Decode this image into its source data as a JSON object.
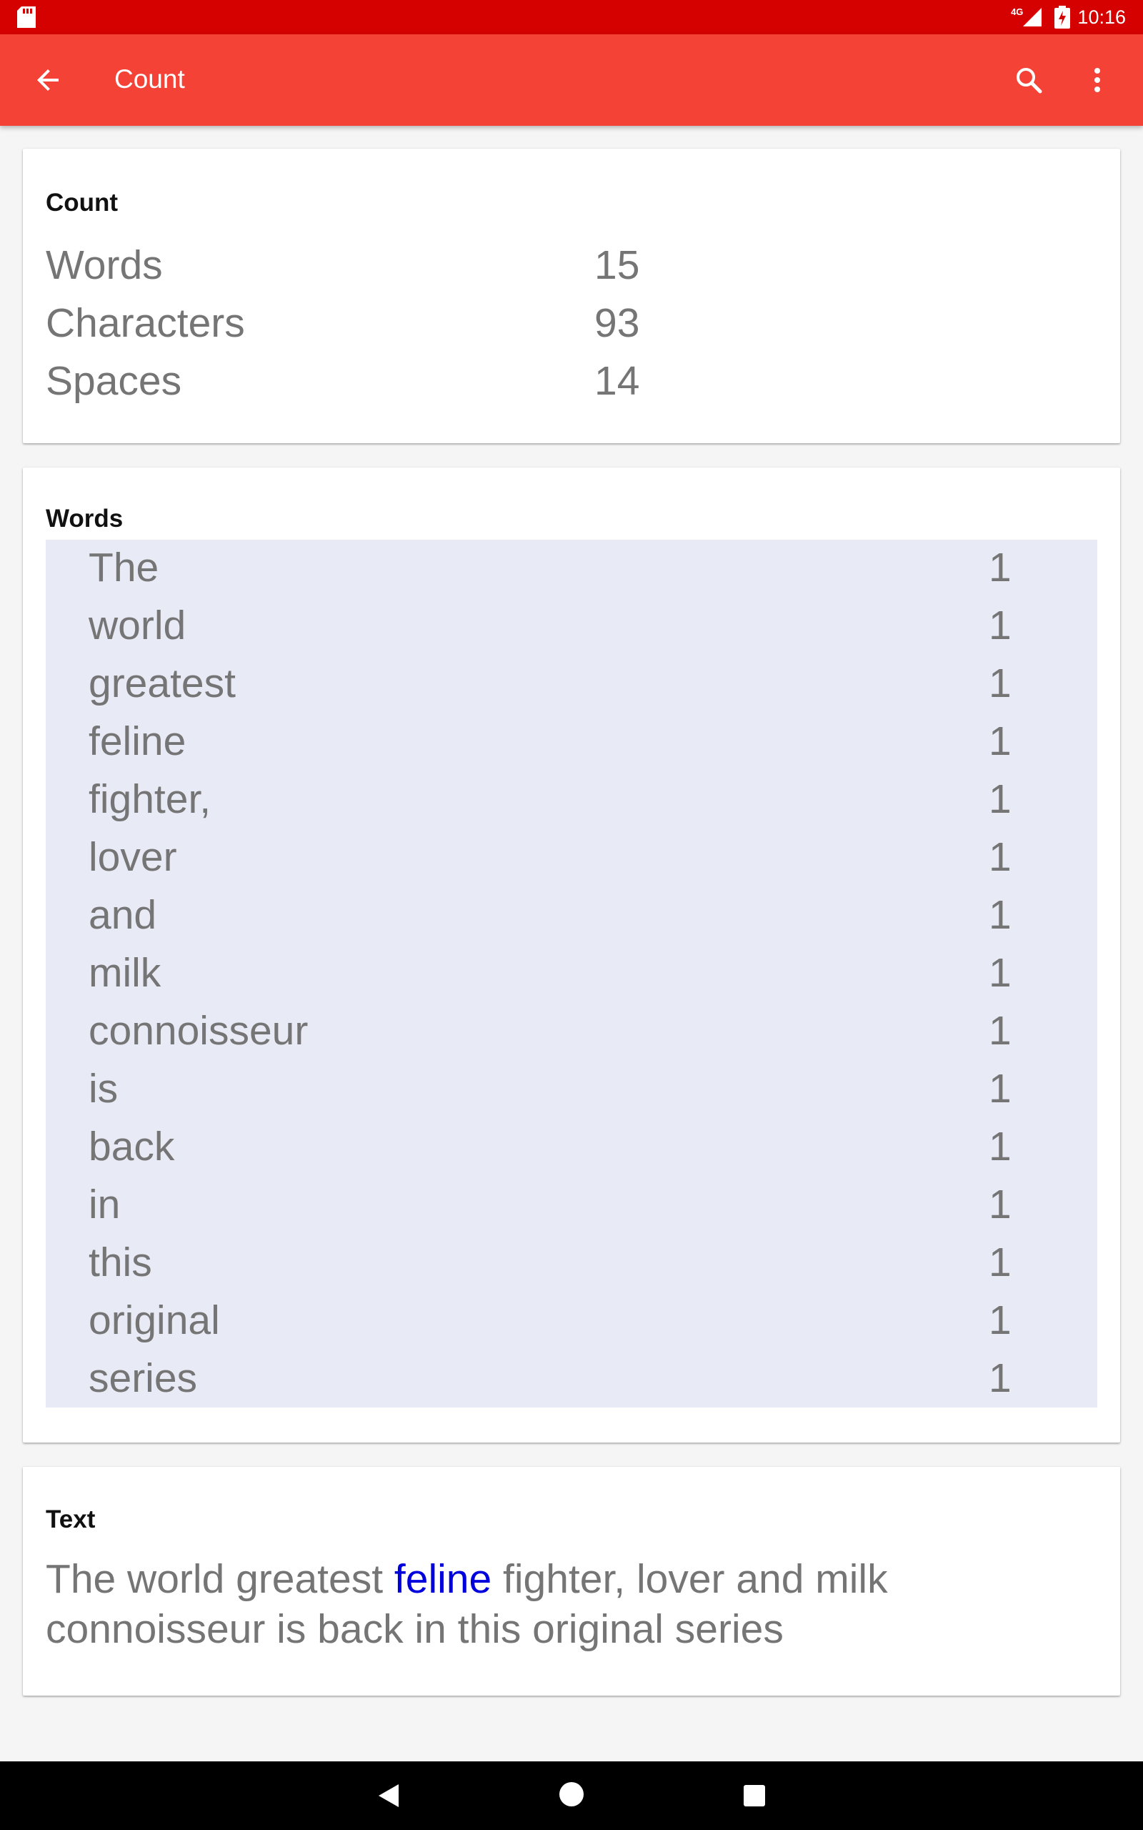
{
  "status_bar": {
    "network": "4G",
    "time": "10:16"
  },
  "app_bar": {
    "title": "Count"
  },
  "count_card": {
    "title": "Count",
    "rows": [
      {
        "label": "Words",
        "value": "15"
      },
      {
        "label": "Characters",
        "value": "93"
      },
      {
        "label": "Spaces",
        "value": "14"
      }
    ]
  },
  "words_card": {
    "title": "Words",
    "items": [
      {
        "word": "The",
        "count": "1"
      },
      {
        "word": "world",
        "count": "1"
      },
      {
        "word": "greatest",
        "count": "1"
      },
      {
        "word": "feline",
        "count": "1"
      },
      {
        "word": "fighter,",
        "count": "1"
      },
      {
        "word": "lover",
        "count": "1"
      },
      {
        "word": "and",
        "count": "1"
      },
      {
        "word": "milk",
        "count": "1"
      },
      {
        "word": "connoisseur",
        "count": "1"
      },
      {
        "word": "is",
        "count": "1"
      },
      {
        "word": "back",
        "count": "1"
      },
      {
        "word": "in",
        "count": "1"
      },
      {
        "word": "this",
        "count": "1"
      },
      {
        "word": "original",
        "count": "1"
      },
      {
        "word": "series",
        "count": "1"
      }
    ]
  },
  "text_card": {
    "title": "Text",
    "before": "The world greatest ",
    "highlight": "feline",
    "after": " fighter, lover and milk connoisseur is back in this original series",
    "highlight_color": "#0000dd"
  },
  "colors": {
    "status_bar": "#d50000",
    "app_bar": "#f44336",
    "words_bg": "#e8eaf6"
  }
}
